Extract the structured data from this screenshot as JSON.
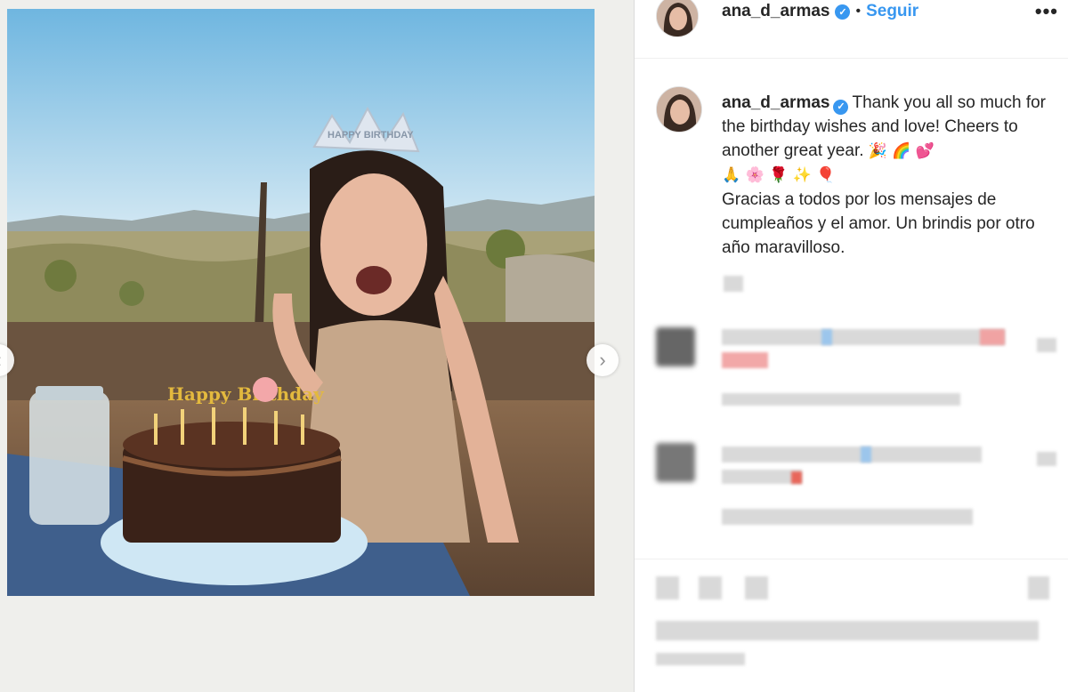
{
  "post": {
    "username": "ana_d_armas",
    "verified_mark": "✓",
    "separator": "•",
    "follow_label": "Seguir",
    "more_label": "•••"
  },
  "caption": {
    "username": "ana_d_armas",
    "line_en": "Thank you all so much for the birthday wishes and love! Cheers to another great year.",
    "emojis_en": "🎉 🌈 💕",
    "emojis_2": "🙏 🌸 🌹 ✨ 🎈",
    "line_es": "Gracias a todos por los mensajes de cumpleaños y el amor. Un brindis por otro año maravilloso."
  },
  "photo": {
    "crown_text": "HAPPY BIRTHDAY",
    "cake_topper_text": "Happy Birthday"
  },
  "navigation": {
    "next_label": "›",
    "prev_label": "‹"
  },
  "colors": {
    "accent": "#3897f0",
    "text": "#262626",
    "border": "#dbdbdb"
  },
  "icons": [
    "verified-badge-icon",
    "more-options-icon",
    "chevron-right-icon"
  ]
}
